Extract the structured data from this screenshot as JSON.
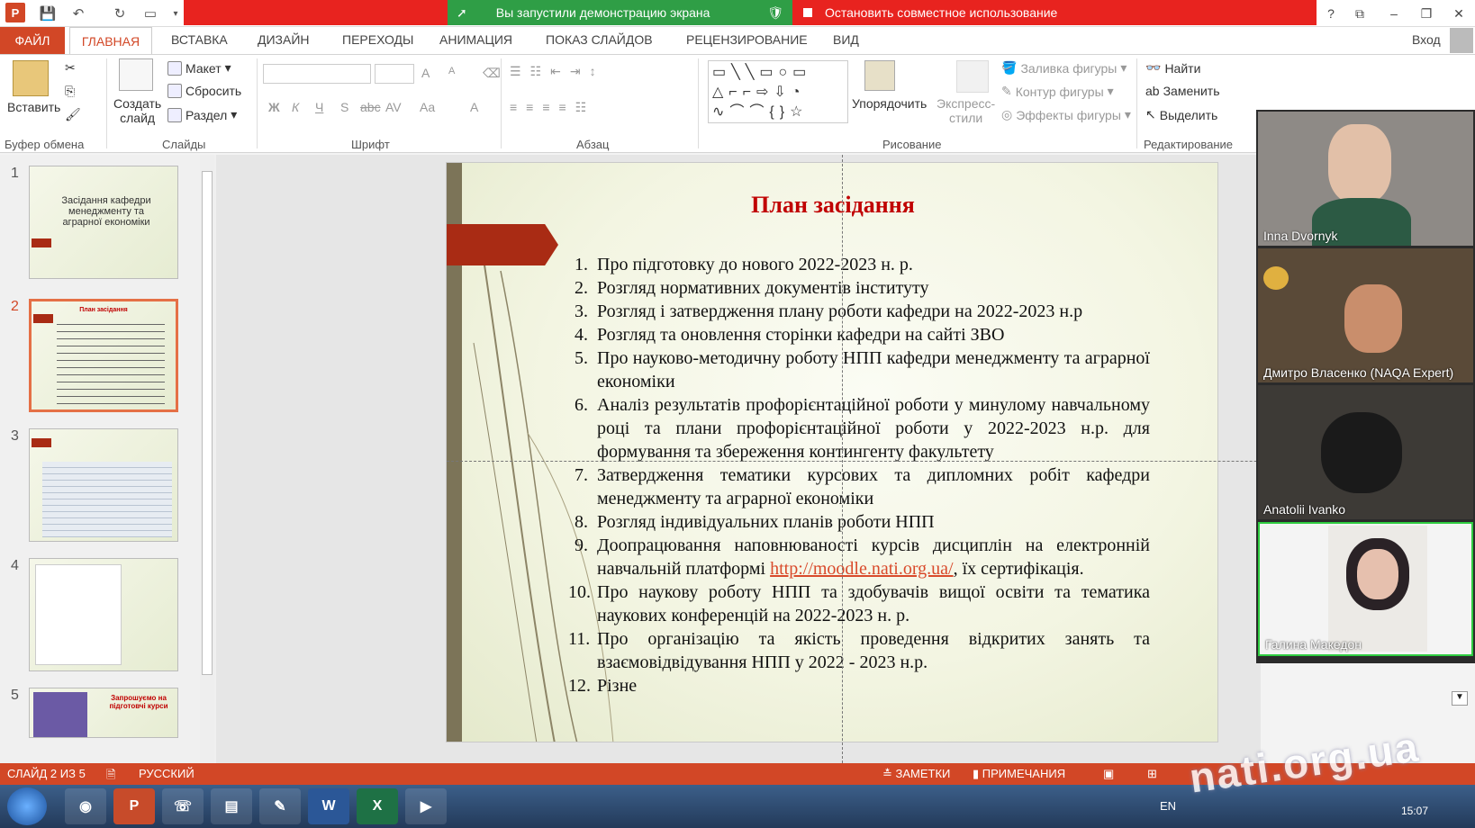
{
  "share": {
    "demo_text": "Вы запустили демонстрацию экрана",
    "stop_text": "Остановить совместное использование"
  },
  "tabs": [
    "ФАЙЛ",
    "ГЛАВНАЯ",
    "ВСТАВКА",
    "ДИЗАЙН",
    "ПЕРЕХОДЫ",
    "АНИМАЦИЯ",
    "ПОКАЗ СЛАЙДОВ",
    "РЕЦЕНЗИРОВАНИЕ",
    "ВИД"
  ],
  "signin": "Вход",
  "ribbon": {
    "clipboard": {
      "paste": "Вставить",
      "label": "Буфер обмена"
    },
    "slides": {
      "new_slide_1": "Создать",
      "new_slide_2": "слайд",
      "layout": "Макет",
      "reset": "Сбросить",
      "section": "Раздел",
      "label": "Слайды"
    },
    "font": {
      "label": "Шрифт",
      "bold": "Ж",
      "italic": "К",
      "underline": "Ч",
      "shadow": "S",
      "strike": "abc",
      "spacing": "AV",
      "case": "Aa",
      "grow": "A",
      "shrink": "A"
    },
    "paragraph": {
      "label": "Абзац"
    },
    "drawing": {
      "arrange": "Упорядочить",
      "styles_1": "Экспресс-",
      "styles_2": "стили",
      "fill": "Заливка фигуры",
      "outline": "Контур фигуры",
      "effects": "Эффекты фигуры",
      "label": "Рисование"
    },
    "editing": {
      "find": "Найти",
      "replace": "Заменить",
      "select": "Выделить",
      "label": "Редактирование"
    }
  },
  "thumbnails": [
    {
      "num": "1",
      "text": "Засідання кафедри менеджменту та аграрної економіки"
    },
    {
      "num": "2",
      "text": "План засідання"
    },
    {
      "num": "3",
      "text": ""
    },
    {
      "num": "4",
      "text": ""
    },
    {
      "num": "5",
      "text": "Запрошуємо на підготовчі курси"
    }
  ],
  "slide": {
    "title": "План засідання",
    "items": [
      {
        "n": "1.",
        "t": "Про підготовку до нового 2022-2023 н. р."
      },
      {
        "n": "2.",
        "t": "Розгляд нормативних документів інституту"
      },
      {
        "n": "3.",
        "t": "Розгляд і затвердження плану роботи кафедри на 2022-2023 н.р"
      },
      {
        "n": "4.",
        "t": "Розгляд та оновлення сторінки кафедри на сайті ЗВО"
      },
      {
        "n": "5.",
        "t": "Про науково-методичну роботу НПП кафедри менеджменту та аграрної економіки"
      },
      {
        "n": "6.",
        "t": "Аналіз результатів профорієнтаційної роботи у минулому навчальному році та плани профорієнтаційної роботи у 2022-2023 н.р. для формування та збереження контингенту факультету"
      },
      {
        "n": "7.",
        "t": "Затвердження тематики курсових та дипломних робіт кафедри менеджменту та аграрної економіки"
      },
      {
        "n": "8.",
        "t": "Розгляд індивідуальних планів роботи НПП"
      },
      {
        "n": "9.",
        "t_before": "Доопрацювання наповнюваності курсів дисциплін на електронній навчальній платформі ",
        "link": "http://moodle.nati.org.ua/",
        "t_after": ", їх сертифікація."
      },
      {
        "n": "10.",
        "t": "Про наукову роботу НПП та здобувачів вищої освіти та тематика наукових конференцій на 2022-2023 н. р."
      },
      {
        "n": "11.",
        "t": "Про організацію та якість проведення відкритих занять та взаємовідвідування НПП у 2022 - 2023 н.р."
      },
      {
        "n": "12.",
        "t": "Різне"
      }
    ]
  },
  "participants": [
    {
      "name": "Inna Dvornyk",
      "bg": "#8e8a86"
    },
    {
      "name": "Дмитро Власенко (NAQA Expert)",
      "bg": "#5a4a38"
    },
    {
      "name": "Anatolii Ivanko",
      "bg": "#3d3a36"
    },
    {
      "name": "Галина Македон",
      "bg": "#f4f4f4"
    }
  ],
  "status": {
    "slide_count": "СЛАЙД 2 ИЗ 5",
    "language": "РУССКИЙ",
    "notes": "ЗАМЕТКИ",
    "comments": "ПРИМЕЧАНИЯ"
  },
  "taskbar": {
    "lang": "EN",
    "time": "15:07"
  },
  "watermark": "nati.org.ua"
}
